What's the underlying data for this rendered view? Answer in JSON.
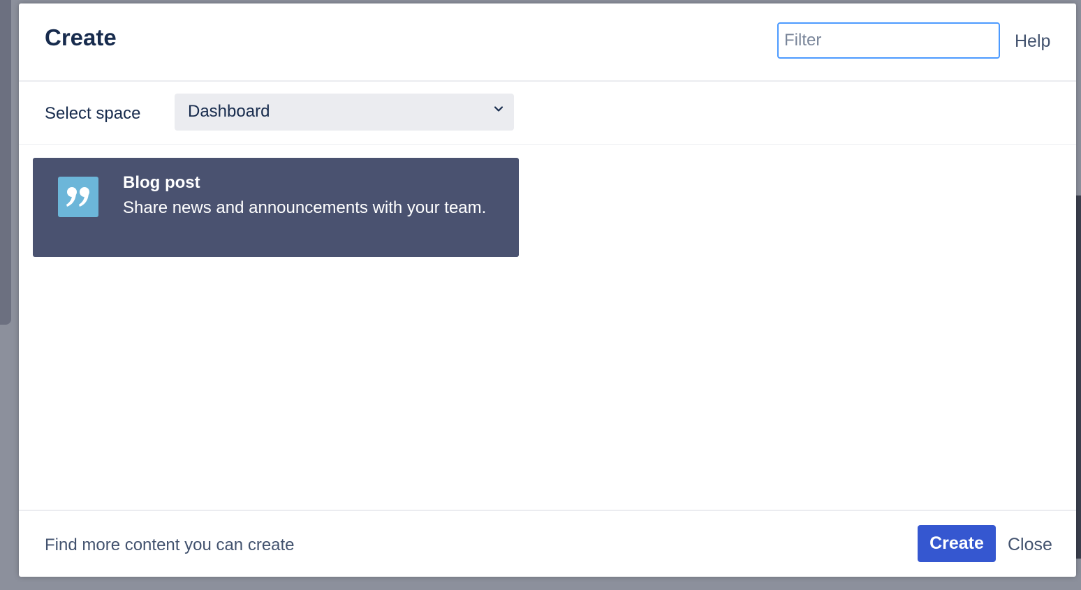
{
  "dialog": {
    "title": "Create",
    "filter": {
      "placeholder": "Filter",
      "value": ""
    },
    "help_label": "Help"
  },
  "space": {
    "label": "Select space",
    "selected": "Dashboard"
  },
  "templates": [
    {
      "name": "Blog post",
      "description": "Share news and announcements with your team.",
      "icon": "quote-icon",
      "selected": true
    }
  ],
  "footer": {
    "more_link": "Find more content you can create",
    "create_label": "Create",
    "close_label": "Close"
  },
  "colors": {
    "primary": "#3557d0",
    "tile_selected_bg": "#4a5270",
    "tile_icon_bg": "#6cb6d9",
    "focus_border": "#4c9aff"
  }
}
